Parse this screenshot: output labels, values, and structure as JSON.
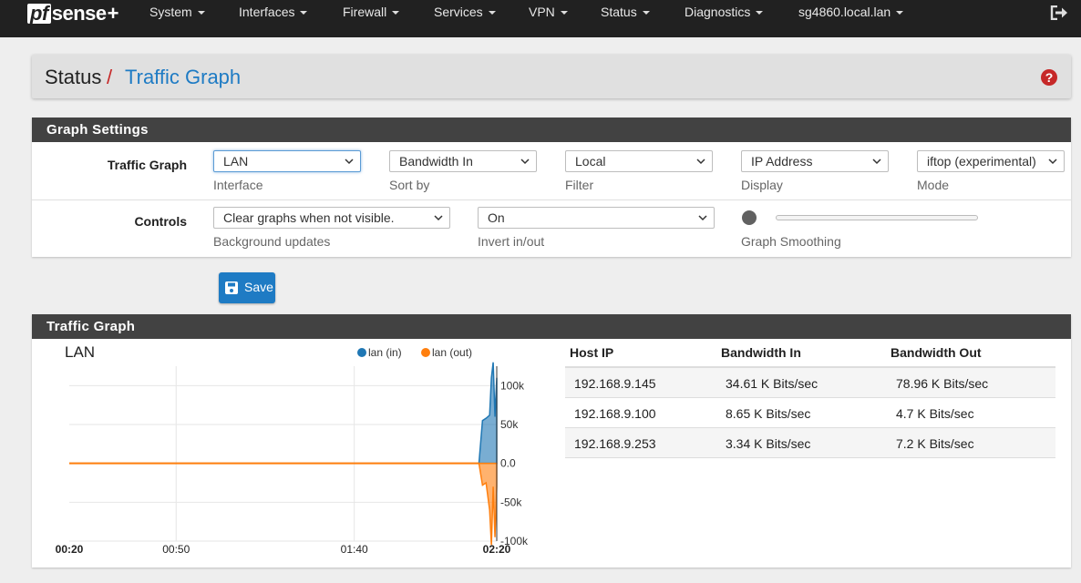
{
  "nav": {
    "brand_pf": "pf",
    "brand_rest": "sense",
    "brand_plus": "+",
    "items": [
      "System",
      "Interfaces",
      "Firewall",
      "Services",
      "VPN",
      "Status",
      "Diagnostics",
      "sg4860.local.lan"
    ]
  },
  "breadcrumb": {
    "section": "Status",
    "separator": "/",
    "page": "Traffic Graph"
  },
  "settings": {
    "title": "Graph Settings",
    "traffic_graph_label": "Traffic Graph",
    "controls_label": "Controls",
    "interface": {
      "value": "LAN",
      "help": "Interface"
    },
    "sort_by": {
      "value": "Bandwidth In",
      "help": "Sort by"
    },
    "filter": {
      "value": "Local",
      "help": "Filter"
    },
    "display": {
      "value": "IP Address",
      "help": "Display"
    },
    "mode": {
      "value": "iftop (experimental)",
      "help": "Mode"
    },
    "background_updates": {
      "value": "Clear graphs when not visible.",
      "help": "Background updates"
    },
    "invert": {
      "value": "On",
      "help": "Invert in/out"
    },
    "smoothing": {
      "help": "Graph Smoothing",
      "level": 0
    },
    "save_label": "Save"
  },
  "traffic": {
    "title": "Traffic Graph",
    "graph_name": "LAN",
    "legend_in": "lan (in)",
    "legend_out": "lan (out)",
    "headers": {
      "host": "Host IP",
      "bw_in": "Bandwidth In",
      "bw_out": "Bandwidth Out"
    },
    "rows": [
      {
        "host": "192.168.9.145",
        "bw_in": "34.61 K Bits/sec",
        "bw_out": "78.96 K Bits/sec"
      },
      {
        "host": "192.168.9.100",
        "bw_in": "8.65 K Bits/sec",
        "bw_out": "4.7 K Bits/sec"
      },
      {
        "host": "192.168.9.253",
        "bw_in": "3.34 K Bits/sec",
        "bw_out": "7.2 K Bits/sec"
      }
    ]
  },
  "colors": {
    "in": "#1f77b4",
    "out": "#ff7f0e",
    "accent": "#1e7bc4"
  },
  "chart_data": {
    "type": "area",
    "title": "LAN",
    "x_ticks": [
      "00:20",
      "00:50",
      "01:40",
      "02:20"
    ],
    "y_ticks": [
      "100k",
      "50k",
      "0.0",
      "-50k",
      "-100k"
    ],
    "ylim": [
      -100000,
      125000
    ],
    "series": [
      {
        "name": "lan (in)",
        "x": [
          "02:15",
          "02:16",
          "02:17",
          "02:18",
          "02:18.5",
          "02:19",
          "02:19.5",
          "02:20"
        ],
        "values": [
          0,
          55000,
          58000,
          62000,
          110000,
          130000,
          60000,
          110000
        ]
      },
      {
        "name": "lan (out)",
        "x": [
          "02:15",
          "02:16",
          "02:17",
          "02:18",
          "02:18.5",
          "02:19",
          "02:19.5",
          "02:20"
        ],
        "values": [
          0,
          -28000,
          -25000,
          -60000,
          -105000,
          -30000,
          -95000,
          -30000
        ]
      }
    ]
  }
}
